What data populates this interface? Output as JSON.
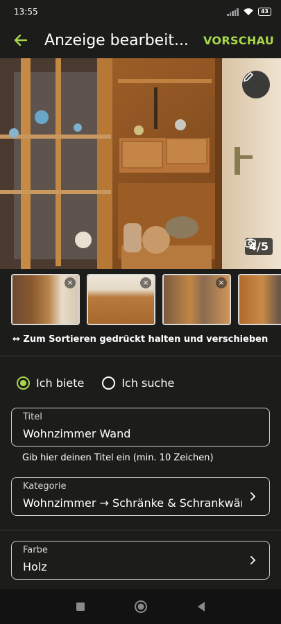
{
  "status_bar": {
    "time": "13:55",
    "battery": "43"
  },
  "header": {
    "title": "Anzeige bearbeit...",
    "preview_label": "VORSCHAU"
  },
  "photo": {
    "counter": "4/5"
  },
  "thumbnails": [
    {
      "remove": "×"
    },
    {
      "remove": "×"
    },
    {
      "remove": "×"
    },
    {
      "remove": "×"
    }
  ],
  "sort_hint": "↔ Zum Sortieren gedrückt halten und verschieben",
  "offer_type": {
    "offer_label": "Ich biete",
    "search_label": "Ich suche",
    "selected": "Ich biete"
  },
  "form": {
    "title_label": "Titel",
    "title_value": "Wohnzimmer Wand",
    "title_hint": "Gib hier deinen Titel ein (min. 10 Zeichen)",
    "category_label": "Kategorie",
    "category_value": "Wohnzimmer → Schränke & Schrankwände",
    "color_label": "Farbe",
    "color_value": "Holz"
  },
  "colors": {
    "accent": "#a7d84c",
    "background": "#1c1c1a"
  }
}
